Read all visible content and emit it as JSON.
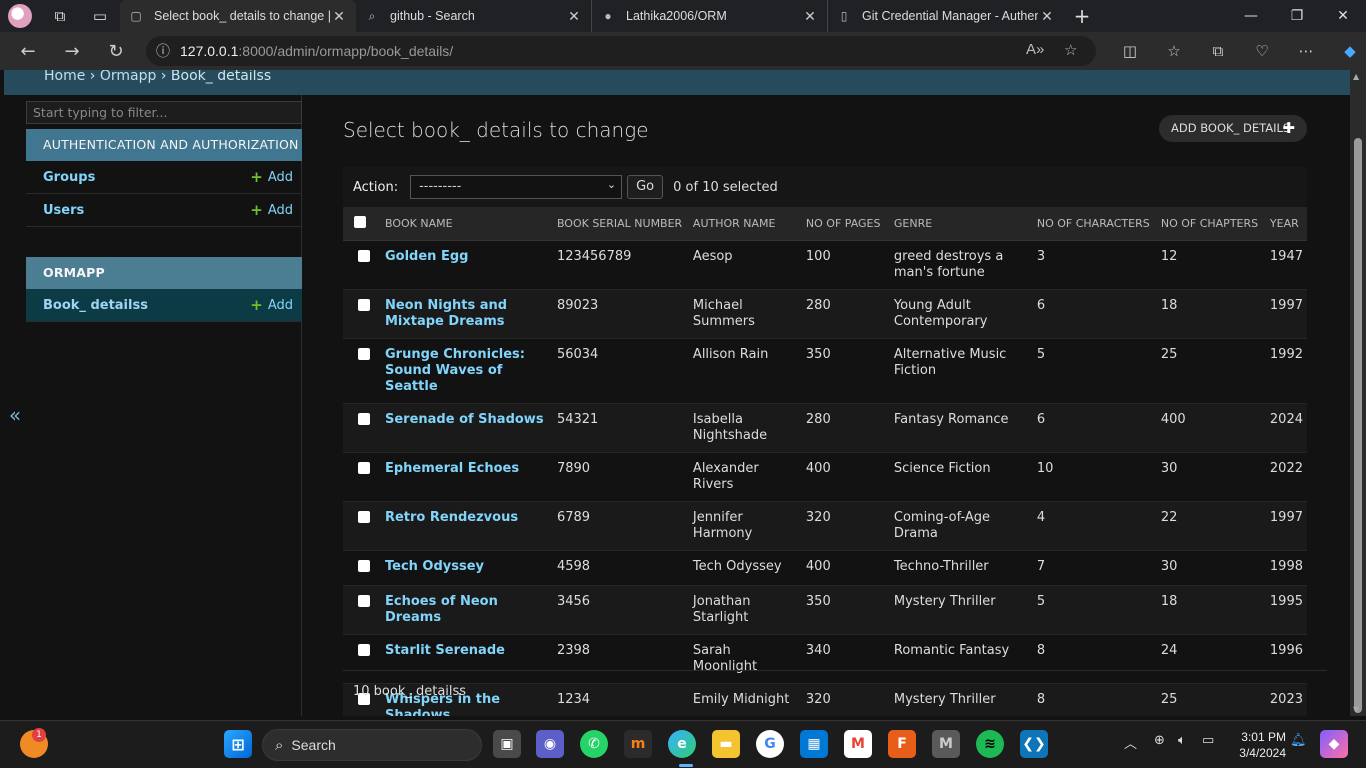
{
  "browser": {
    "tabs": [
      {
        "title": "Select book_ details to change | Dj",
        "icon": "django-page-icon",
        "active": true
      },
      {
        "title": "github - Search",
        "icon": "search-icon",
        "active": false
      },
      {
        "title": "Lathika2006/ORM",
        "icon": "github-icon",
        "active": false
      },
      {
        "title": "Git Credential Manager - Authen",
        "icon": "page-icon",
        "active": false
      }
    ],
    "url_host": "127.0.0.1",
    "url_path": ":8000/admin/ormapp/book_details/"
  },
  "breadcrumbs": {
    "home": "Home",
    "sep": "›",
    "app": "Ormapp",
    "model": "Book_ detailss"
  },
  "sidebar": {
    "filter_placeholder": "Start typing to filter...",
    "modules": [
      {
        "title": "AUTHENTICATION AND AUTHORIZATION",
        "items": [
          {
            "label": "Groups",
            "add": "Add"
          },
          {
            "label": "Users",
            "add": "Add"
          }
        ]
      },
      {
        "title": "ORMAPP",
        "items": [
          {
            "label": "Book_ detailss",
            "add": "Add"
          }
        ]
      }
    ],
    "collapse_label": "«"
  },
  "main": {
    "title": "Select book_ details to change",
    "add_button": "ADD BOOK_ DETAILS",
    "action_label": "Action:",
    "action_value": "---------",
    "go_label": "Go",
    "selected_count": "0 of 10 selected",
    "columns": [
      "BOOK NAME",
      "BOOK SERIAL NUMBER",
      "AUTHOR NAME",
      "NO OF PAGES",
      "GENRE",
      "NO OF CHARACTERS",
      "NO OF CHAPTERS",
      "YEAR"
    ],
    "rows": [
      [
        "Golden Egg",
        "123456789",
        "Aesop",
        "100",
        "greed destroys a man's fortune",
        "3",
        "12",
        "1947"
      ],
      [
        "Neon Nights and Mixtape Dreams",
        "89023",
        "Michael Summers",
        "280",
        "Young Adult Contemporary",
        "6",
        "18",
        "1997"
      ],
      [
        "Grunge Chronicles: Sound Waves of Seattle",
        "56034",
        "Allison Rain",
        "350",
        "Alternative Music Fiction",
        "5",
        "25",
        "1992"
      ],
      [
        "Serenade of Shadows",
        "54321",
        "Isabella Nightshade",
        "280",
        "Fantasy Romance",
        "6",
        "400",
        "2024"
      ],
      [
        "Ephemeral Echoes",
        "7890",
        "Alexander Rivers",
        "400",
        "Science Fiction",
        "10",
        "30",
        "2022"
      ],
      [
        "Retro Rendezvous",
        "6789",
        "Jennifer Harmony",
        "320",
        "Coming-of-Age Drama",
        "4",
        "22",
        "1997"
      ],
      [
        "Tech Odyssey",
        "4598",
        "Tech Odyssey",
        "400",
        "Techno-Thriller",
        "7",
        "30",
        "1998"
      ],
      [
        "Echoes of Neon Dreams",
        "3456",
        "Jonathan Starlight",
        "350",
        "Mystery Thriller",
        "5",
        "18",
        "1995"
      ],
      [
        "Starlit Serenade",
        "2398",
        "Sarah Moonlight",
        "340",
        "Romantic Fantasy",
        "8",
        "24",
        "1996"
      ],
      [
        "Whispers in the Shadows",
        "1234",
        "Emily Midnight",
        "320",
        "Mystery Thriller",
        "8",
        "25",
        "2023"
      ]
    ],
    "paginator": "10 book_ detailss"
  },
  "taskbar": {
    "search_label": "Search",
    "time": "3:01 PM",
    "date": "3/4/2024",
    "notification_count": "1",
    "apps": [
      "windows-start",
      "search",
      "task-view",
      "teams-meet",
      "whatsapp",
      "moodle",
      "edge",
      "file-explorer",
      "chrome",
      "microsoft-store",
      "gmail",
      "fiddler",
      "app-m",
      "spotify",
      "vscode"
    ]
  }
}
